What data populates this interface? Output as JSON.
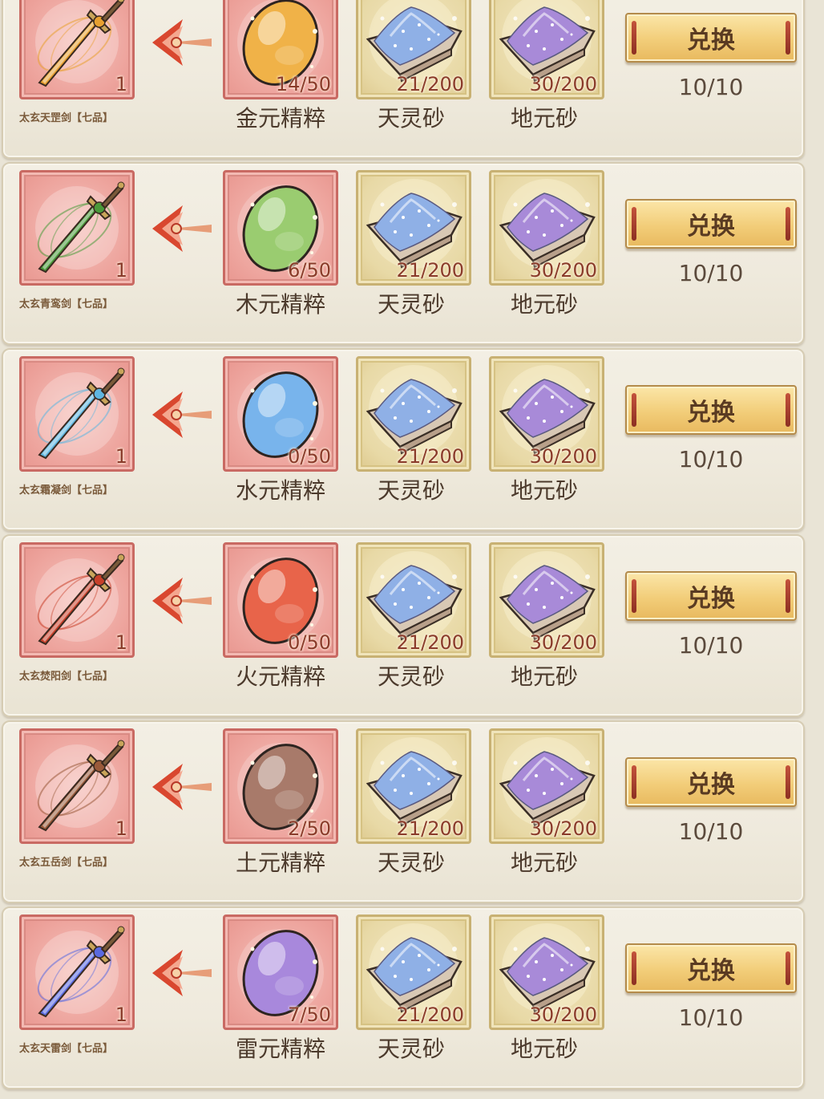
{
  "colors": {
    "row_bg": "#f0ebdf",
    "red_slot": "#eda39c",
    "gold_slot": "#e8d9a6",
    "button": "#f2cd79",
    "count_text": "#8a3b2a"
  },
  "sand_materials": [
    {
      "name": "天灵砂",
      "owned": "21",
      "required": "200",
      "color": "#8fb0e6",
      "icon": "heavenly-sand-icon"
    },
    {
      "name": "地元砂",
      "owned": "30",
      "required": "200",
      "color": "#a88ad8",
      "icon": "earth-sand-icon"
    }
  ],
  "rows": [
    {
      "sword_name": "太玄天罡剑【七品】",
      "sword_qty": "1",
      "sword_icon": "golden-sword-icon",
      "sword_color": "#e8a030",
      "essence_name": "金元精粹",
      "essence_owned": "14",
      "essence_required": "50",
      "essence_color": "#f0b248",
      "essence_icon": "gold-essence-icon",
      "button_label": "兑换",
      "limit": "10/10"
    },
    {
      "sword_name": "太玄青鸾剑【七品】",
      "sword_qty": "1",
      "sword_icon": "green-sword-icon",
      "sword_color": "#4a9a3a",
      "essence_name": "木元精粹",
      "essence_owned": "6",
      "essence_required": "50",
      "essence_color": "#9acc70",
      "essence_icon": "wood-essence-icon",
      "button_label": "兑换",
      "limit": "10/10"
    },
    {
      "sword_name": "太玄霜凝剑【七品】",
      "sword_qty": "1",
      "sword_icon": "ice-sword-icon",
      "sword_color": "#5fb6e0",
      "essence_name": "水元精粹",
      "essence_owned": "0",
      "essence_required": "50",
      "essence_color": "#78b4ec",
      "essence_icon": "water-essence-icon",
      "button_label": "兑换",
      "limit": "10/10"
    },
    {
      "sword_name": "太玄焚阳剑【七品】",
      "sword_qty": "1",
      "sword_icon": "fire-sword-icon",
      "sword_color": "#c8402a",
      "essence_name": "火元精粹",
      "essence_owned": "0",
      "essence_required": "50",
      "essence_color": "#e8644a",
      "essence_icon": "fire-essence-icon",
      "button_label": "兑换",
      "limit": "10/10"
    },
    {
      "sword_name": "太玄五岳剑【七品】",
      "sword_qty": "1",
      "sword_icon": "earth-sword-icon",
      "sword_color": "#9a5a3a",
      "essence_name": "土元精粹",
      "essence_owned": "2",
      "essence_required": "50",
      "essence_color": "#a87a6a",
      "essence_icon": "earth-essence-icon",
      "button_label": "兑换",
      "limit": "10/10"
    },
    {
      "sword_name": "太玄天雷剑【七品】",
      "sword_qty": "1",
      "sword_icon": "thunder-sword-icon",
      "sword_color": "#5a6ae0",
      "essence_name": "雷元精粹",
      "essence_owned": "7",
      "essence_required": "50",
      "essence_color": "#a888dc",
      "essence_icon": "thunder-essence-icon",
      "button_label": "兑换",
      "limit": "10/10"
    }
  ]
}
